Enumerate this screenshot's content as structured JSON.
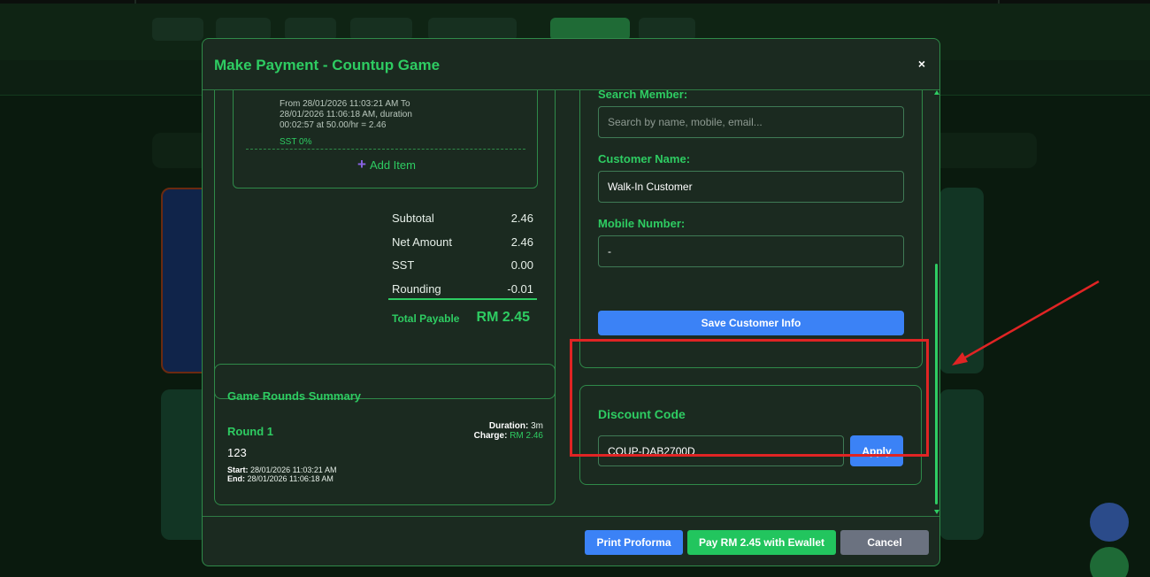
{
  "modal": {
    "title": "Make Payment - Countup Game",
    "close_label": "×"
  },
  "bill_item": {
    "description": "From 28/01/2026 11:03:21 AM To 28/01/2026 11:06:18 AM, duration 00:02:57 at 50.00/hr = 2.46",
    "tax_label": "SST 0%",
    "add_item_icon": "+",
    "add_item_label": "Add Item"
  },
  "totals": {
    "subtotal_label": "Subtotal",
    "subtotal_value": "2.46",
    "net_label": "Net Amount",
    "net_value": "2.46",
    "sst_label": "SST",
    "sst_value": "0.00",
    "rounding_label": "Rounding",
    "rounding_value": "-0.01",
    "total_label": "Total Payable",
    "total_value": "RM 2.45"
  },
  "rounds": {
    "title": "Game Rounds Summary",
    "round_name": "Round 1",
    "duration_label": "Duration:",
    "duration_value": "3m",
    "charge_label": "Charge:",
    "charge_value": "RM 2.46",
    "note": "123",
    "start_label": "Start:",
    "start_value": "28/01/2026 11:03:21 AM",
    "end_label": "End:",
    "end_value": "28/01/2026 11:06:18 AM"
  },
  "customer": {
    "search_label": "Search Member:",
    "search_placeholder": "Search by name, mobile, email...",
    "name_label": "Customer Name:",
    "name_value": "Walk-In Customer",
    "mobile_label": "Mobile Number:",
    "mobile_value": "-",
    "save_label": "Save Customer Info"
  },
  "discount": {
    "title": "Discount Code",
    "code_value": "COUP-DAB2700D",
    "apply_label": "Apply"
  },
  "footer": {
    "print_label": "Print Proforma",
    "pay_label": "Pay RM 2.45 with Ewallet",
    "cancel_label": "Cancel"
  },
  "colors": {
    "accent": "#2ecc62",
    "primary_button": "#3b82f6",
    "pay_button": "#22c55e",
    "cancel_button": "#6b7280",
    "highlight": "#e02424"
  }
}
